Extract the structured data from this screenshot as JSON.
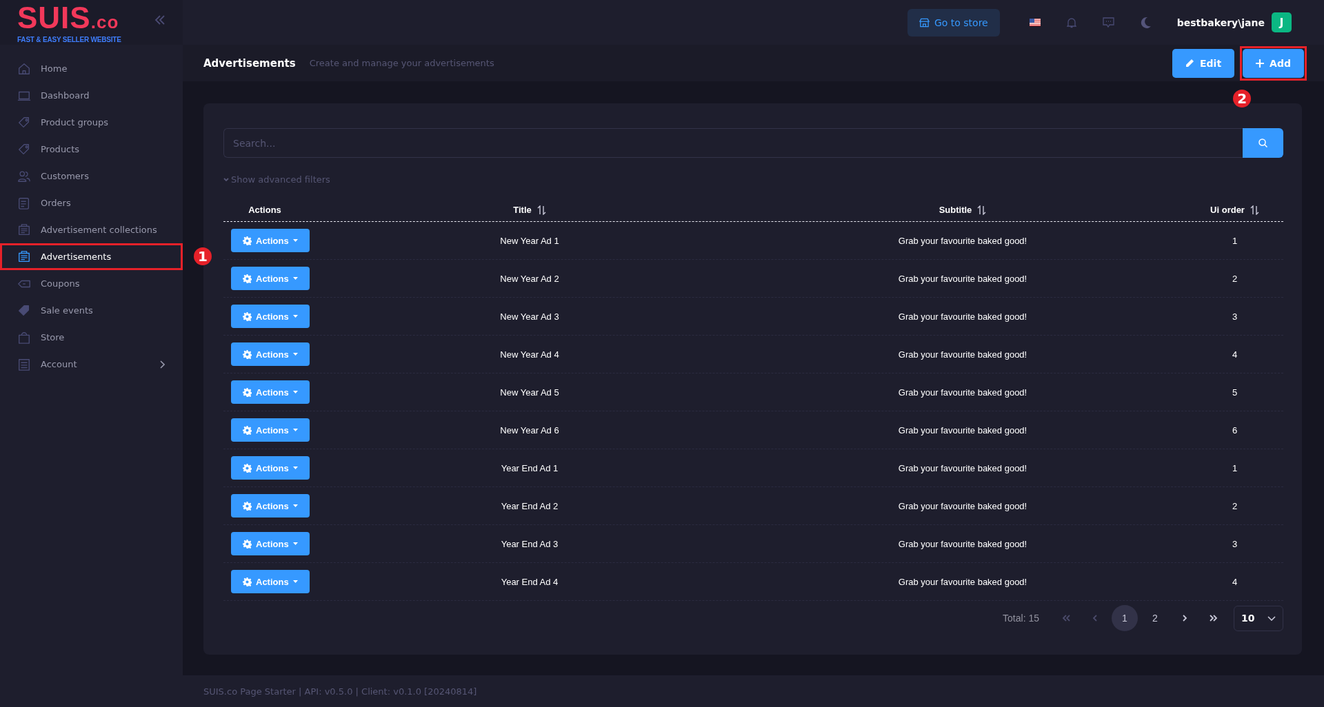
{
  "logo": {
    "name": "SUIS",
    "suffix": ".co",
    "tagline": "FAST & EASY SELLER WEBSITE"
  },
  "sidebar": {
    "items": [
      {
        "label": "Home",
        "selected": false
      },
      {
        "label": "Dashboard",
        "selected": false
      },
      {
        "label": "Product groups",
        "selected": false
      },
      {
        "label": "Products",
        "selected": false
      },
      {
        "label": "Customers",
        "selected": false
      },
      {
        "label": "Orders",
        "selected": false
      },
      {
        "label": "Advertisement collections",
        "selected": false
      },
      {
        "label": "Advertisements",
        "selected": true,
        "callout": "1"
      },
      {
        "label": "Coupons",
        "selected": false
      },
      {
        "label": "Sale events",
        "selected": false
      },
      {
        "label": "Store",
        "selected": false
      },
      {
        "label": "Account",
        "selected": false,
        "submenu": true
      }
    ]
  },
  "topbar": {
    "store_button": "Go to store",
    "user": "bestbakery\\jane",
    "avatar": "J"
  },
  "page": {
    "title": "Advertisements",
    "subtitle": "Create and manage your advertisements",
    "buttons": [
      {
        "label": "Edit",
        "kind": "edit"
      },
      {
        "label": "Add",
        "kind": "add",
        "callout": "2"
      }
    ]
  },
  "search": {
    "placeholder": "Search..."
  },
  "filters_toggle": "Show advanced filters",
  "table": {
    "columns": [
      {
        "label": "Actions",
        "sortable": false
      },
      {
        "label": "Title",
        "sortable": true
      },
      {
        "label": "Subtitle",
        "sortable": true
      },
      {
        "label": "Ui order",
        "sortable": true
      }
    ],
    "rows": [
      {
        "action": "Actions",
        "title": "New Year Ad 1",
        "subtitle": "Grab your favourite baked good!",
        "ui_order": "1"
      },
      {
        "action": "Actions",
        "title": "New Year Ad 2",
        "subtitle": "Grab your favourite baked good!",
        "ui_order": "2"
      },
      {
        "action": "Actions",
        "title": "New Year Ad 3",
        "subtitle": "Grab your favourite baked good!",
        "ui_order": "3"
      },
      {
        "action": "Actions",
        "title": "New Year Ad 4",
        "subtitle": "Grab your favourite baked good!",
        "ui_order": "4"
      },
      {
        "action": "Actions",
        "title": "New Year Ad 5",
        "subtitle": "Grab your favourite baked good!",
        "ui_order": "5"
      },
      {
        "action": "Actions",
        "title": "New Year Ad 6",
        "subtitle": "Grab your favourite baked good!",
        "ui_order": "6"
      },
      {
        "action": "Actions",
        "title": "Year End Ad 1",
        "subtitle": "Grab your favourite baked good!",
        "ui_order": "1"
      },
      {
        "action": "Actions",
        "title": "Year End Ad 2",
        "subtitle": "Grab your favourite baked good!",
        "ui_order": "2"
      },
      {
        "action": "Actions",
        "title": "Year End Ad 3",
        "subtitle": "Grab your favourite baked good!",
        "ui_order": "3"
      },
      {
        "action": "Actions",
        "title": "Year End Ad 4",
        "subtitle": "Grab your favourite baked good!",
        "ui_order": "4"
      }
    ]
  },
  "pagination": {
    "total": "Total: 15",
    "pages": [
      {
        "label": "1",
        "selected": true
      },
      {
        "label": "2",
        "selected": false
      }
    ],
    "page_size": "10"
  },
  "footer": "SUIS.co Page Starter | API: v0.5.0 | Client: v0.1.0 [20240814]"
}
